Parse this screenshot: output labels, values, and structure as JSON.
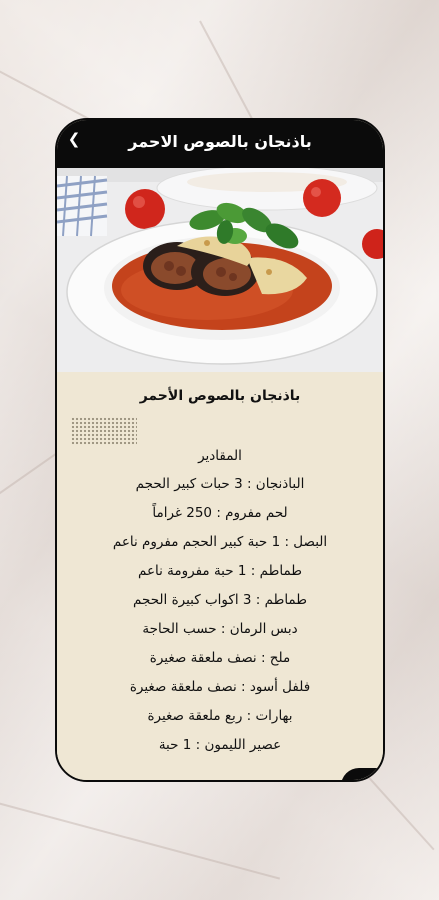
{
  "header": {
    "back_icon": "back-arrow-icon",
    "title": "باذنجان بالصوص الاحمر"
  },
  "recipe": {
    "title": "باذنجان بالصوص الأحمر",
    "section_heading": "المقادير",
    "ingredients": [
      "الباذنجان : 3 حبات كبير الحجم",
      "لحم مفروم : 250 غراماً",
      "البصل : 1 حبة كبير الحجم مفروم ناعم",
      "طماطم : 1 حبة مفرومة ناعم",
      "طماطم : 3 اكواب كبيرة الحجم",
      "دبس الرمان : حسب الحاجة",
      "ملح : نصف ملعقة صغيرة",
      "فلفل أسود : نصف ملعقة صغيرة",
      "بهارات : ربع ملعقة صغيرة",
      "عصير الليمون : 1 حبة"
    ]
  },
  "colors": {
    "header_bg": "#0b0b0b",
    "content_bg": "#efe7d4",
    "sauce": "#c4431c"
  }
}
